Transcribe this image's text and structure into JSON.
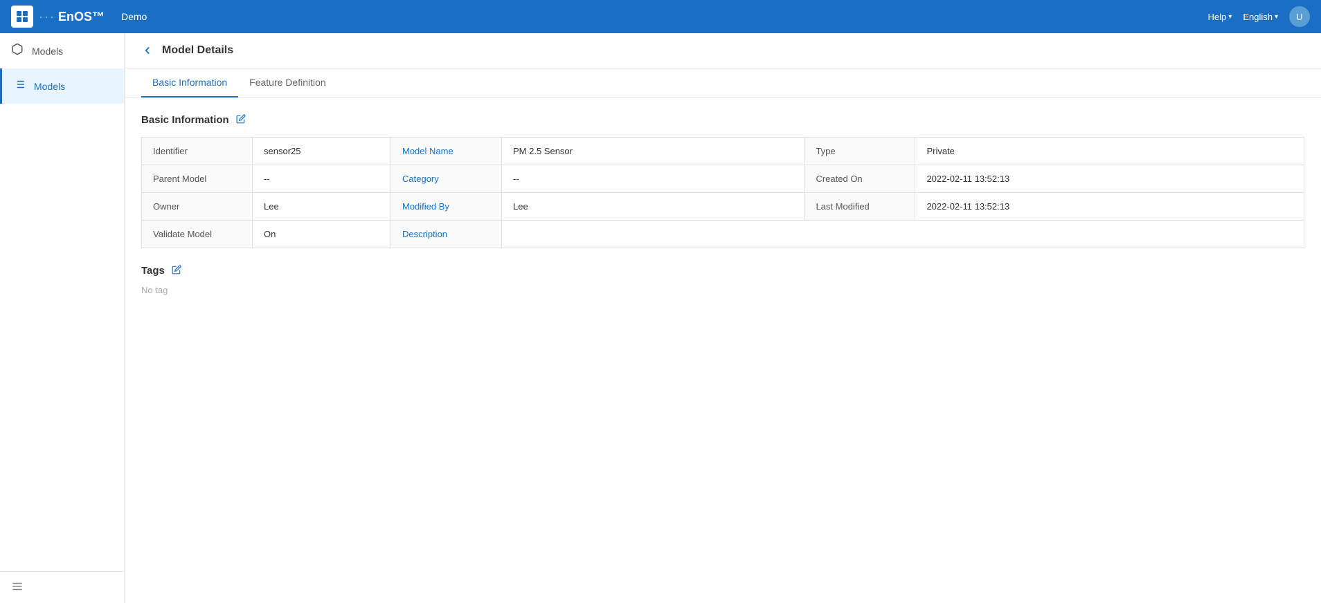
{
  "topNav": {
    "logoDotsLabel": "···",
    "logoText": "EnOS™",
    "demoLabel": "Demo",
    "helpLabel": "Help",
    "langLabel": "English",
    "avatarInitial": "U"
  },
  "sidebar": {
    "items": [
      {
        "id": "models",
        "label": "Models",
        "icon": "box",
        "active": false
      },
      {
        "id": "models-nav",
        "label": "Models",
        "icon": "list",
        "active": true
      }
    ],
    "collapseLabel": "Collapse"
  },
  "page": {
    "title": "Model Details",
    "backTooltip": "Back"
  },
  "tabs": [
    {
      "id": "basic",
      "label": "Basic Information",
      "active": true
    },
    {
      "id": "feature",
      "label": "Feature Definition",
      "active": false
    }
  ],
  "basicInfo": {
    "sectionTitle": "Basic Information",
    "rows": [
      {
        "col1Label": "Identifier",
        "col1Value": "sensor25",
        "col2Label": "Model Name",
        "col2Value": "PM 2.5 Sensor",
        "col3Label": "Type",
        "col3Value": "Private"
      },
      {
        "col1Label": "Parent Model",
        "col1Value": "--",
        "col2Label": "Category",
        "col2Value": "--",
        "col3Label": "Created On",
        "col3Value": "2022-02-11 13:52:13"
      },
      {
        "col1Label": "Owner",
        "col1Value": "Lee",
        "col2Label": "Modified By",
        "col2Value": "Lee",
        "col3Label": "Last Modified",
        "col3Value": "2022-02-11 13:52:13"
      },
      {
        "col1Label": "Validate Model",
        "col1Value": "On",
        "col2Label": "Description",
        "col2Value": "",
        "col3Label": "",
        "col3Value": ""
      }
    ]
  },
  "tags": {
    "sectionTitle": "Tags",
    "noTagLabel": "No tag"
  }
}
